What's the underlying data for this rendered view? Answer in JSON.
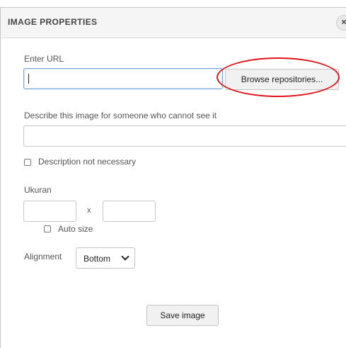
{
  "dialog": {
    "title": "IMAGE PROPERTIES",
    "close_label": "×"
  },
  "url": {
    "label": "Enter URL",
    "value": "",
    "browse_label": "Browse repositories..."
  },
  "description": {
    "label": "Describe this image for someone who cannot see it",
    "value": "",
    "not_necessary_label": "Description not necessary",
    "not_necessary_checked": false
  },
  "size": {
    "label": "Ukuran",
    "width": "",
    "height": "",
    "separator": "x",
    "auto_size_label": "Auto size",
    "auto_size_checked": false
  },
  "alignment": {
    "label": "Alignment",
    "selected": "Bottom"
  },
  "save_label": "Save image",
  "annotation_color": "#e0141a"
}
